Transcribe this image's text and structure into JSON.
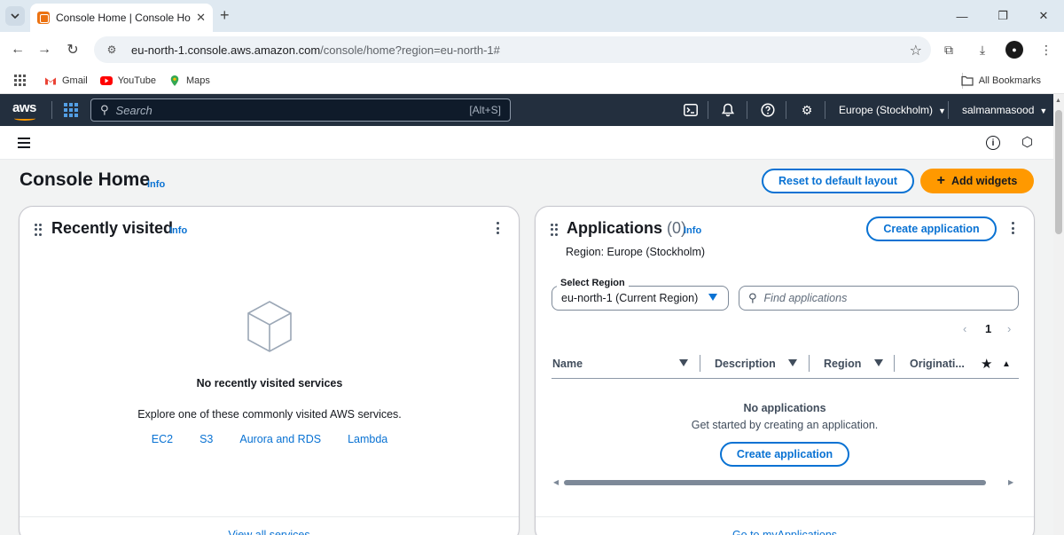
{
  "browser": {
    "tab_title": "Console Home | Console Home",
    "url_host": "eu-north-1.console.aws.amazon.com",
    "url_path": "/console/home?region=eu-north-1#",
    "bookmarks": [
      "Gmail",
      "YouTube",
      "Maps"
    ],
    "all_bookmarks": "All Bookmarks"
  },
  "awsnav": {
    "search_placeholder": "Search",
    "search_shortcut": "[Alt+S]",
    "region": "Europe (Stockholm)",
    "user": "salmanmasood"
  },
  "page": {
    "title": "Console Home",
    "info": "Info",
    "reset_button": "Reset to default layout",
    "add_widgets_button": "Add widgets"
  },
  "recently_visited": {
    "title": "Recently visited",
    "info": "Info",
    "empty_title": "No recently visited services",
    "explore_text": "Explore one of these commonly visited AWS services.",
    "services": [
      "EC2",
      "S3",
      "Aurora and RDS",
      "Lambda"
    ],
    "footer_link": "View all services"
  },
  "applications": {
    "title": "Applications",
    "count": "(0)",
    "info": "Info",
    "create_button": "Create application",
    "region_text": "Region: Europe (Stockholm)",
    "select_label": "Select Region",
    "select_value": "eu-north-1 (Current Region)",
    "find_placeholder": "Find applications",
    "page_number": "1",
    "columns": [
      "Name",
      "Description",
      "Region",
      "Originati..."
    ],
    "empty_title": "No applications",
    "empty_subtitle": "Get started by creating an application.",
    "create_button_2": "Create application",
    "footer_link": "Go to myApplications"
  },
  "colors": {
    "aws_nav": "#232f3e",
    "link_blue": "#0972d3",
    "primary_orange": "#ff9900"
  }
}
